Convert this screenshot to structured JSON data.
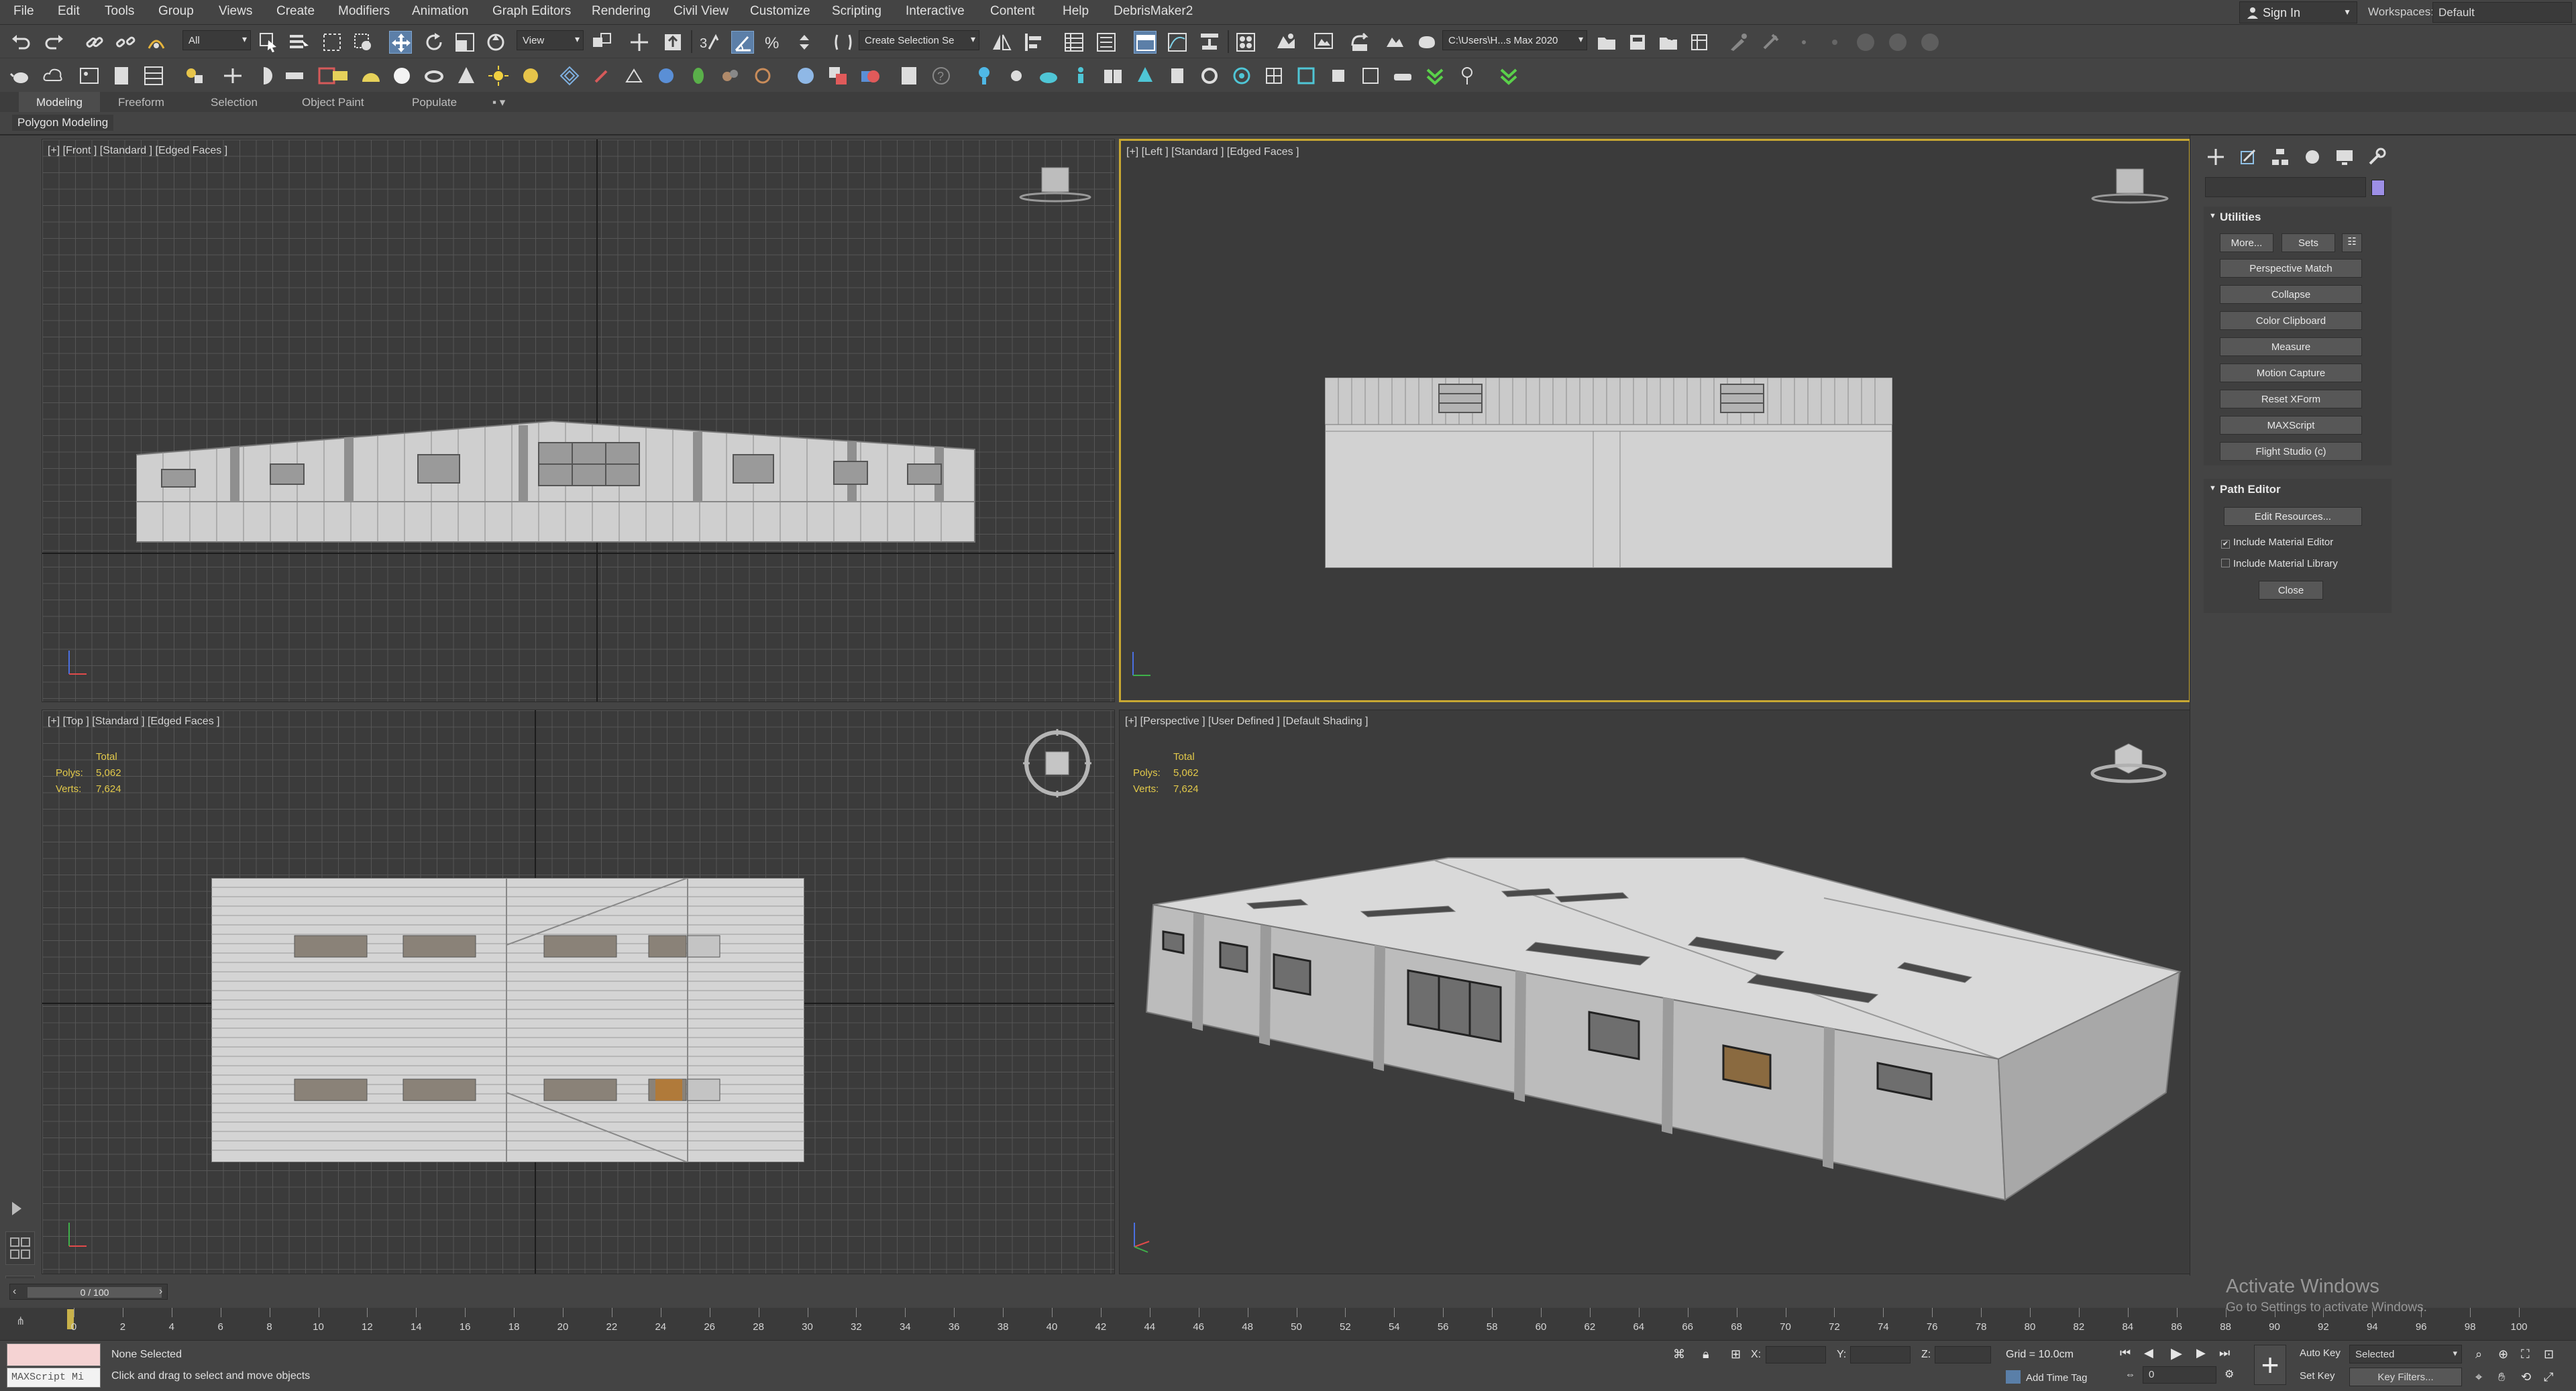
{
  "menubar": {
    "items": [
      "File",
      "Edit",
      "Tools",
      "Group",
      "Views",
      "Create",
      "Modifiers",
      "Animation",
      "Graph Editors",
      "Rendering",
      "Civil View",
      "Customize",
      "Scripting",
      "Interactive",
      "Content",
      "Help",
      "DebrisMaker2"
    ],
    "sign_in": "Sign In",
    "workspaces_label": "Workspaces:",
    "workspace_value": "Default"
  },
  "toolbar": {
    "selection_filter": "All",
    "reference_coord": "View",
    "named_selection": "Create Selection Se",
    "project_path": "C:\\Users\\H...s Max 2020",
    "icons": [
      "undo-icon",
      "redo-icon",
      "link-icon",
      "unlink-icon",
      "bind-space-warp-icon",
      "select-object-icon",
      "select-by-name-icon",
      "rect-selection-icon",
      "window-crossing-icon",
      "select-move-icon",
      "select-rotate-icon",
      "select-scale-icon",
      "placement-icon",
      "snap-toggle-icon",
      "angle-snap-icon",
      "percent-snap-icon",
      "spinner-snap-icon",
      "mirror-icon",
      "align-icon",
      "scene-explorer-icon",
      "layer-explorer-icon",
      "ribbon-toggle-icon",
      "curve-editor-icon",
      "schematic-view-icon",
      "material-editor-icon",
      "render-setup-icon",
      "rendered-frame-window-icon",
      "render-production-icon"
    ]
  },
  "ribbon": {
    "tabs": [
      "Modeling",
      "Freeform",
      "Selection",
      "Object Paint",
      "Populate"
    ],
    "active_tab": "Modeling",
    "panel_label": "Polygon Modeling"
  },
  "viewports": {
    "front": {
      "label": "[+] [Front ] [Standard ] [Edged Faces ]"
    },
    "left": {
      "label": "[+] [Left ] [Standard ] [Edged Faces ]"
    },
    "top": {
      "label": "[+] [Top ] [Standard ] [Edged Faces ]"
    },
    "perspective": {
      "label": "[+] [Perspective ] [User Defined ] [Default Shading ]"
    },
    "stats": {
      "total_label": "Total",
      "polys_label": "Polys:",
      "polys": "5,062",
      "verts_label": "Verts:",
      "verts": "7,624"
    }
  },
  "command_panel": {
    "tabs": [
      "create-icon",
      "modify-icon",
      "hierarchy-icon",
      "motion-icon",
      "display-icon",
      "utilities-icon"
    ],
    "utilities": {
      "title": "Utilities",
      "more_button": "More...",
      "sets_button": "Sets",
      "buttons": [
        "Perspective Match",
        "Collapse",
        "Color Clipboard",
        "Measure",
        "Motion Capture",
        "Reset XForm",
        "MAXScript",
        "Flight Studio (c)"
      ]
    },
    "path_editor": {
      "title": "Path Editor",
      "edit_resources": "Edit Resources...",
      "include_material_editor": "Include Material Editor",
      "include_material_editor_checked": true,
      "include_material_library": "Include Material Library",
      "include_material_library_checked": false,
      "close_button": "Close"
    }
  },
  "timeline": {
    "slider_text": "0 / 100",
    "ticks": [
      "0",
      "2",
      "4",
      "6",
      "8",
      "10",
      "12",
      "14",
      "16",
      "18",
      "20",
      "22",
      "24",
      "26",
      "28",
      "30",
      "32",
      "34",
      "36",
      "38",
      "40",
      "42",
      "44",
      "46",
      "48",
      "50",
      "52",
      "54",
      "56",
      "58",
      "60",
      "62",
      "64",
      "66",
      "68",
      "70",
      "72",
      "74",
      "76",
      "78",
      "80",
      "82",
      "84",
      "86",
      "88",
      "90",
      "92",
      "94",
      "96",
      "98",
      "100"
    ],
    "current_frame": 0
  },
  "statusbar": {
    "maxscript_label": "MAXScript Mi",
    "selection_status": "None Selected",
    "prompt": "Click and drag to select and move objects",
    "x_label": "X:",
    "y_label": "Y:",
    "z_label": "Z:",
    "grid": "Grid = 10.0cm",
    "add_time_tag": "Add Time Tag",
    "frame_value": "0",
    "auto_key": "Auto Key",
    "set_key": "Set Key",
    "selected_dropdown": "Selected",
    "key_filters": "Key Filters..."
  },
  "watermark": {
    "title": "Activate Windows",
    "subtitle": "Go to Settings to activate Windows."
  },
  "colors": {
    "ui_bg": "#444444",
    "viewport_bg": "#3b3b3b",
    "active_viewport_border": "#c8a832",
    "stats_text": "#e2c94a",
    "accent_blue": "#5c7fa8"
  }
}
